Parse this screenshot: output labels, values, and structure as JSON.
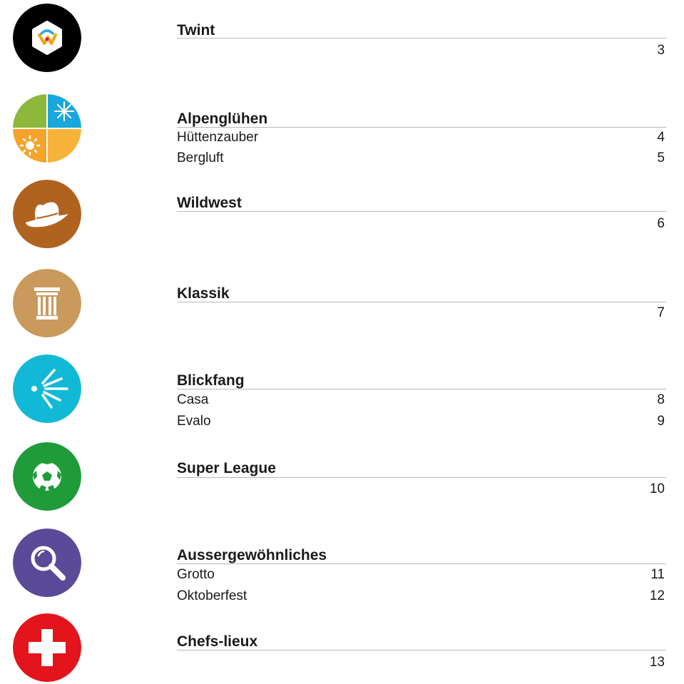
{
  "sections": [
    {
      "title": "Twint",
      "icon": "twint-logo-icon",
      "color": "#000000",
      "items": [
        {
          "label": "",
          "page": "3"
        }
      ]
    },
    {
      "title": "Alpenglühen",
      "icon": "seasons-quadrant-icon",
      "colors": [
        "#8db83a",
        "#1aa7dd",
        "#f4a32b",
        "#f5b33a"
      ],
      "items": [
        {
          "label": "Hüttenzauber",
          "page": "4"
        },
        {
          "label": "Bergluft",
          "page": "5"
        }
      ]
    },
    {
      "title": "Wildwest",
      "icon": "cowboy-hat-icon",
      "color": "#b0631f",
      "items": [
        {
          "label": "",
          "page": "6"
        }
      ]
    },
    {
      "title": "Klassik",
      "icon": "column-icon",
      "color": "#c99a5b",
      "items": [
        {
          "label": "",
          "page": "7"
        }
      ]
    },
    {
      "title": "Blickfang",
      "icon": "sparkle-rays-icon",
      "color": "#12b9d6",
      "items": [
        {
          "label": "Casa",
          "page": "8"
        },
        {
          "label": "Evalo",
          "page": "9"
        }
      ]
    },
    {
      "title": "Super League",
      "icon": "soccer-ball-icon",
      "color": "#1f9b3a",
      "items": [
        {
          "label": "",
          "page": "10"
        }
      ]
    },
    {
      "title": "Aussergewöhnliches",
      "icon": "magnifier-icon",
      "color": "#5a4a98",
      "items": [
        {
          "label": "Grotto",
          "page": "11"
        },
        {
          "label": "Oktoberfest",
          "page": "12"
        }
      ]
    },
    {
      "title": "Chefs-lieux",
      "icon": "swiss-cross-icon",
      "color": "#e3141c",
      "items": [
        {
          "label": "",
          "page": "13"
        }
      ]
    }
  ]
}
